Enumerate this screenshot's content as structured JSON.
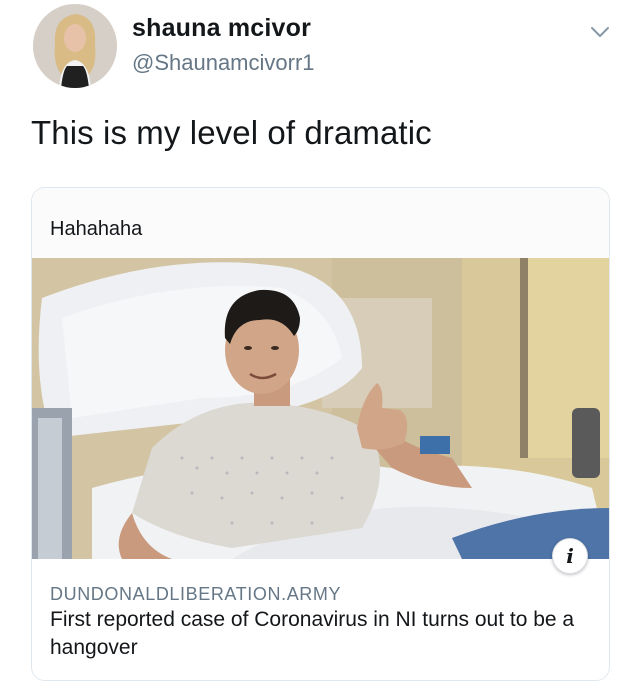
{
  "user": {
    "display_name": "shauna mcivor",
    "handle": "@Shaunamcivorr1",
    "avatar_icon": "profile-avatar"
  },
  "tweet": {
    "text": "This is my level of dramatic"
  },
  "card": {
    "snippet": "Hahahaha",
    "domain": "DUNDONALDLIBERATION.ARMY",
    "title": "First reported case of Coronavirus in NI turns out to be a hangover",
    "info_icon": "i",
    "image_description_icon": "hospital-photo"
  },
  "icons": {
    "menu": "chevron-down-icon"
  },
  "colors": {
    "text_primary": "#14171a",
    "text_secondary": "#657786",
    "border": "#e1e8ed"
  }
}
